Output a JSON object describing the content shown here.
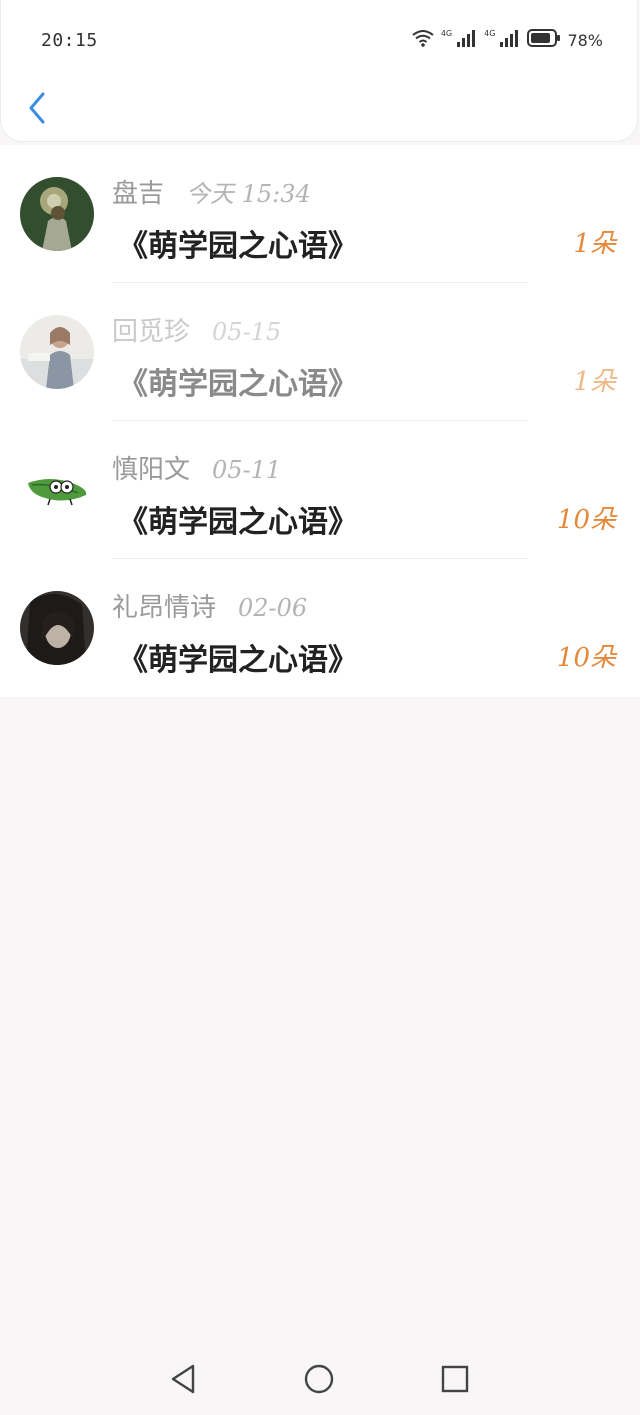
{
  "status_bar": {
    "time": "20:15",
    "battery": "78%",
    "network_1": "4G",
    "network_2": "4G",
    "icons": [
      "wifi-icon",
      "signal-icon",
      "signal-icon",
      "battery-icon"
    ]
  },
  "header": {
    "back_icon": "chevron-left-icon"
  },
  "records": [
    {
      "name": "盘吉",
      "date": "今天 15:34",
      "title": "《萌学园之心语》",
      "amount": "1朵",
      "avatar": "avatar-photo-dark-green"
    },
    {
      "name": "回觅珍",
      "date": "05-15",
      "title": "《萌学园之心语》",
      "amount": "1朵",
      "avatar": "avatar-photo-light"
    },
    {
      "name": "慎阳文",
      "date": "05-11",
      "title": "《萌学园之心语》",
      "amount": "10朵",
      "avatar": "avatar-cartoon-leaf"
    },
    {
      "name": "礼昂情诗",
      "date": "02-06",
      "title": "《萌学园之心语》",
      "amount": "10朵",
      "avatar": "avatar-photo-dark"
    }
  ],
  "nav_bar": {
    "icons": [
      "back-triangle-icon",
      "home-circle-icon",
      "recents-square-icon"
    ]
  },
  "colors": {
    "accent_blue": "#3a8ee6",
    "amount_orange": "#e4883a",
    "background": "#f8f6f7"
  }
}
